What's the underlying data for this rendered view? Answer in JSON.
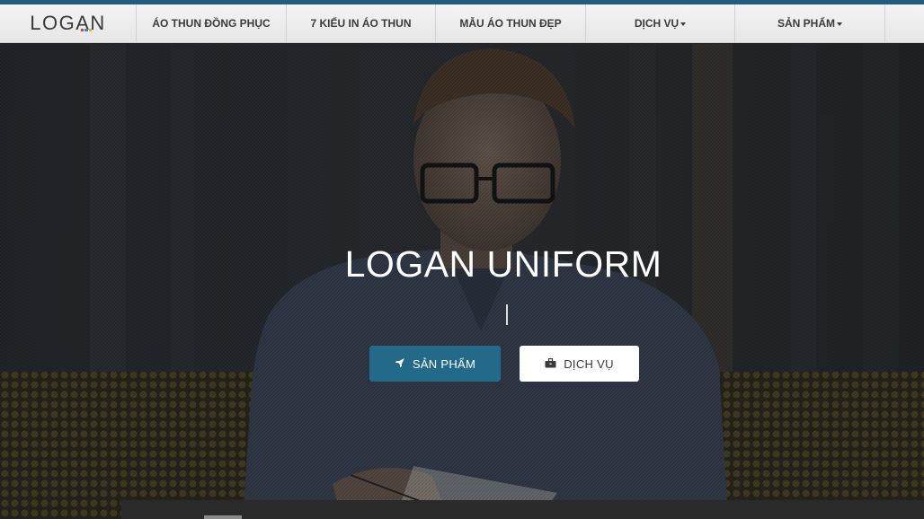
{
  "brand": {
    "logo_text": "LOGAN",
    "bar_colors": [
      "#e23b3b",
      "#2f8fd0",
      "#f2b619"
    ]
  },
  "nav": {
    "items": [
      {
        "label": "ÁO THUN ĐỒNG PHỤC",
        "dropdown": false
      },
      {
        "label": "7 KIỂU IN ÁO THUN",
        "dropdown": false
      },
      {
        "label": "MẪU ÁO THUN ĐẸP",
        "dropdown": false
      },
      {
        "label": "DỊCH VỤ",
        "dropdown": true
      },
      {
        "label": "SẢN PHẨM",
        "dropdown": true
      }
    ]
  },
  "hero": {
    "title": "LOGAN UNIFORM",
    "primary_button": {
      "label": "SẢN PHẨM",
      "icon": "rocket-icon"
    },
    "secondary_button": {
      "label": "DỊCH VỤ",
      "icon": "briefcase-icon"
    }
  },
  "colors": {
    "accent": "#236a8a",
    "topline": "#1f5e7e"
  }
}
